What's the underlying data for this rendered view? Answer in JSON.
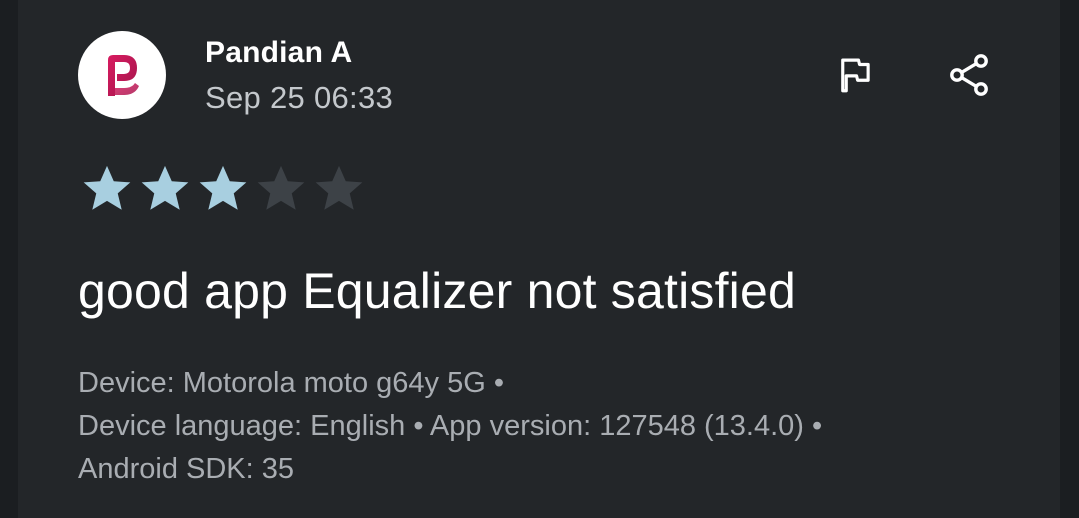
{
  "review": {
    "author": "Pandian A",
    "date": "Sep 25 06:33",
    "rating": 3,
    "max_rating": 5,
    "text": "good app Equalizer not satisfied",
    "device_line_1": "Device: Motorola moto g64y 5G •",
    "device_line_2": "Device language: English • App version: 127548 (13.4.0) •",
    "device_line_3": "Android SDK: 35"
  },
  "icons": {
    "avatar": "parler-logo-icon",
    "flag": "flag-icon",
    "share": "share-icon",
    "star": "star-icon"
  },
  "colors": {
    "background": "#232629",
    "star_filled": "#a8cfe0",
    "star_empty": "#3d4247",
    "logo": "#c2185b",
    "text_primary": "#ffffff",
    "text_secondary": "#a9adb2"
  }
}
